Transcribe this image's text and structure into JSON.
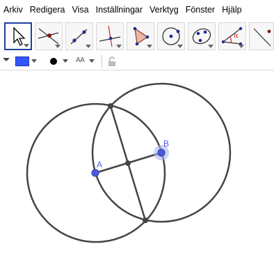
{
  "menu": [
    "Arkiv",
    "Redigera",
    "Visa",
    "Inställningar",
    "Verktyg",
    "Fönster",
    "Hjälp"
  ],
  "toolbar": {
    "tools": [
      {
        "name": "move-tool",
        "icon": "arrow-pointer-icon"
      },
      {
        "name": "point-tool",
        "icon": "point-on-lines-icon"
      },
      {
        "name": "line-tool",
        "icon": "line-through-points-icon"
      },
      {
        "name": "perpendicular-tool",
        "icon": "perpendicular-line-icon"
      },
      {
        "name": "polygon-tool",
        "icon": "polygon-icon"
      },
      {
        "name": "circle-tool",
        "icon": "circle-center-point-icon"
      },
      {
        "name": "conic-tool",
        "icon": "conic-through-points-icon"
      },
      {
        "name": "angle-tool",
        "icon": "angle-icon",
        "label": "α"
      },
      {
        "name": "reflect-tool",
        "icon": "reflect-icon"
      }
    ]
  },
  "stylebar": {
    "color_label": "",
    "color": "#3355ff",
    "text_size_label": "AA"
  },
  "graphics": {
    "points": [
      {
        "label": "A",
        "color": "#4b5bdf"
      },
      {
        "label": "B",
        "color": "#4b5bdf"
      }
    ]
  }
}
